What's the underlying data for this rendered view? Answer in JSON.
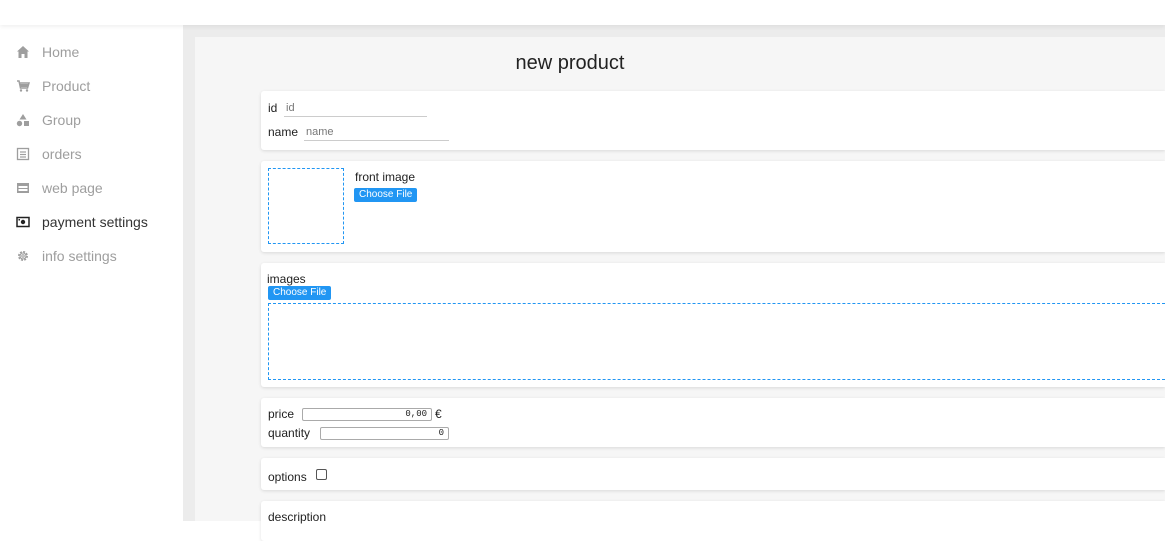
{
  "sidebar": {
    "items": [
      {
        "label": "Home",
        "icon": "home-icon"
      },
      {
        "label": "Product",
        "icon": "cart-icon"
      },
      {
        "label": "Group",
        "icon": "shapes-icon"
      },
      {
        "label": "orders",
        "icon": "list-icon"
      },
      {
        "label": "web page",
        "icon": "window-icon"
      },
      {
        "label": "payment settings",
        "icon": "cash-icon"
      },
      {
        "label": "info settings",
        "icon": "gear-icon"
      }
    ]
  },
  "page": {
    "title": "new product"
  },
  "basic": {
    "id_label": "id",
    "id_placeholder": "id",
    "name_label": "name",
    "name_placeholder": "name"
  },
  "front_image": {
    "label": "front image",
    "button_label": "Choose File"
  },
  "images": {
    "label": "images",
    "button_label": "Choose File"
  },
  "pricing": {
    "price_label": "price",
    "price_value": "0,00",
    "currency": "€",
    "quantity_label": "quantity",
    "quantity_value": "0"
  },
  "options": {
    "label": "options",
    "checked": false
  },
  "description": {
    "label": "description"
  },
  "colors": {
    "accent": "#2196f3",
    "active_text": "#333333",
    "muted_text": "#9e9e9e"
  }
}
